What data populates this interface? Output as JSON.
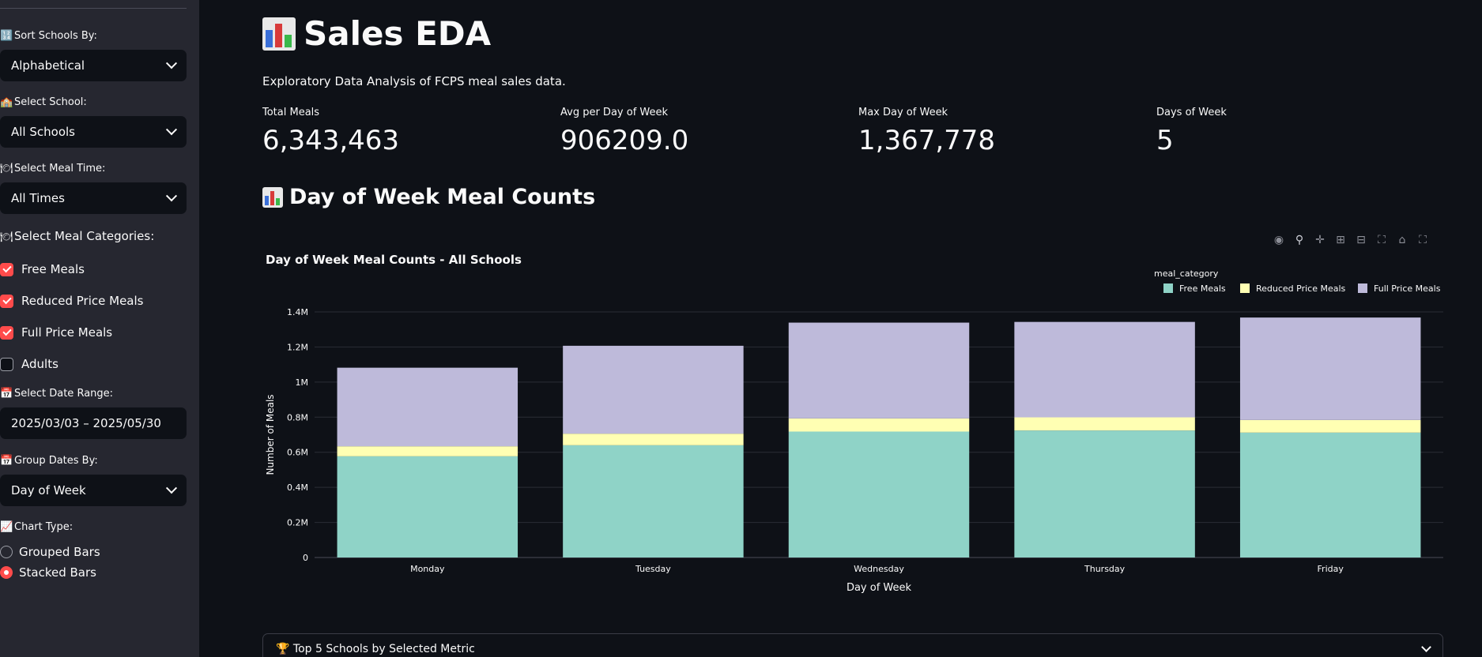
{
  "sidebar": {
    "sort_label": "Sort Schools By:",
    "sort_value": "Alphabetical",
    "school_label": "Select School:",
    "school_value": "All Schools",
    "mealtime_label": "Select Meal Time:",
    "mealtime_value": "All Times",
    "categories_label": "Select Meal Categories:",
    "categories": [
      {
        "label": "Free Meals",
        "checked": true
      },
      {
        "label": "Reduced Price Meals",
        "checked": true
      },
      {
        "label": "Full Price Meals",
        "checked": true
      },
      {
        "label": "Adults",
        "checked": false
      }
    ],
    "daterange_label": "Select Date Range:",
    "daterange_value": "2025/03/03 – 2025/05/30",
    "groupby_label": "Group Dates By:",
    "groupby_value": "Day of Week",
    "charttype_label": "Chart Type:",
    "charttype_options": [
      {
        "label": "Grouped Bars",
        "selected": false
      },
      {
        "label": "Stacked Bars",
        "selected": true
      }
    ]
  },
  "main": {
    "title": "Sales EDA",
    "subtitle": "Exploratory Data Analysis of FCPS meal sales data.",
    "metrics": [
      {
        "label": "Total Meals",
        "value": "6,343,463"
      },
      {
        "label": "Avg per Day of Week",
        "value": "906209.0"
      },
      {
        "label": "Max Day of Week",
        "value": "1,367,778"
      },
      {
        "label": "Days of Week",
        "value": "5"
      }
    ],
    "section_title": "Day of Week Meal Counts",
    "expander_label": "Top 5 Schools by Selected Metric"
  },
  "colors": {
    "accent": "#ff4b4b",
    "free": "#8fd3c7",
    "reduced": "#ffffb3",
    "full": "#bebada"
  },
  "chart_data": {
    "type": "bar",
    "stacked": true,
    "title": "Day of Week Meal Counts - All Schools",
    "xlabel": "Day of Week",
    "ylabel": "Number of Meals",
    "legend_title": "meal_category",
    "legend_position": "top-right",
    "categories": [
      "Monday",
      "Tuesday",
      "Wednesday",
      "Thursday",
      "Friday"
    ],
    "series": [
      {
        "name": "Free Meals",
        "color": "#8fd3c7",
        "values": [
          577000,
          640000,
          718000,
          724000,
          712000
        ]
      },
      {
        "name": "Reduced Price Meals",
        "color": "#ffffb3",
        "values": [
          57000,
          66000,
          75000,
          75000,
          72000
        ]
      },
      {
        "name": "Full Price Meals",
        "color": "#bebada",
        "values": [
          448000,
          501000,
          546000,
          544000,
          584000
        ]
      }
    ],
    "ylim": [
      0,
      1400000
    ],
    "yticks": [
      0,
      200000,
      400000,
      600000,
      800000,
      1000000,
      1200000,
      1400000
    ],
    "ytick_labels": [
      "0",
      "0.2M",
      "0.4M",
      "0.6M",
      "0.8M",
      "1M",
      "1.2M",
      "1.4M"
    ],
    "grid": true
  }
}
